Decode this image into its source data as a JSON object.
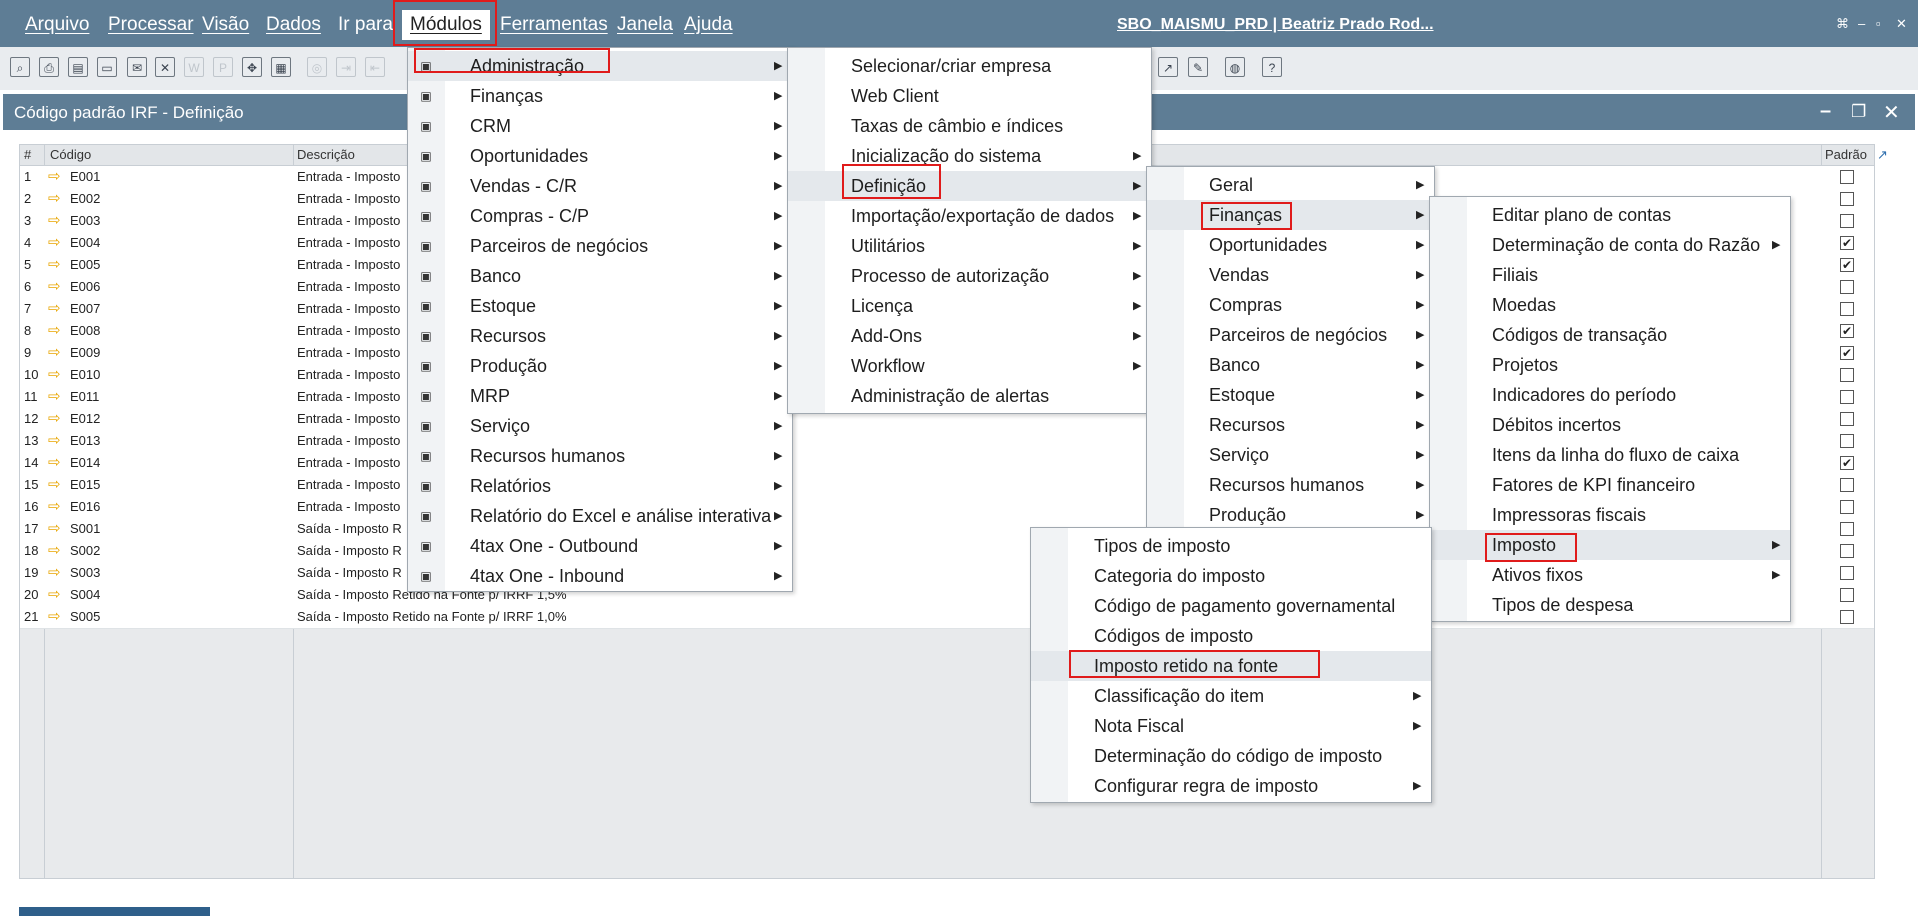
{
  "menubar": {
    "items": [
      "Arquivo",
      "Processar",
      "Visão",
      "Dados",
      "Ir para",
      "Módulos",
      "Ferramentas",
      "Janela",
      "Ajuda"
    ],
    "user_title": "SBO_MAISMU_PRD | Beatriz Prado Rod..."
  },
  "document": {
    "title": "Código padrão IRF - Definição",
    "columns": {
      "num": "#",
      "code": "Código",
      "desc": "Descrição",
      "default": "Padrão"
    },
    "rows": [
      {
        "n": "1",
        "code": "E001",
        "desc": "Entrada - Imposto",
        "default": false
      },
      {
        "n": "2",
        "code": "E002",
        "desc": "Entrada - Imposto",
        "default": false
      },
      {
        "n": "3",
        "code": "E003",
        "desc": "Entrada - Imposto",
        "default": false
      },
      {
        "n": "4",
        "code": "E004",
        "desc": "Entrada - Imposto",
        "default": true
      },
      {
        "n": "5",
        "code": "E005",
        "desc": "Entrada - Imposto",
        "default": true
      },
      {
        "n": "6",
        "code": "E006",
        "desc": "Entrada - Imposto",
        "default": false
      },
      {
        "n": "7",
        "code": "E007",
        "desc": "Entrada - Imposto",
        "default": false
      },
      {
        "n": "8",
        "code": "E008",
        "desc": "Entrada - Imposto",
        "default": true
      },
      {
        "n": "9",
        "code": "E009",
        "desc": "Entrada - Imposto",
        "default": true
      },
      {
        "n": "10",
        "code": "E010",
        "desc": "Entrada - Imposto",
        "default": false
      },
      {
        "n": "11",
        "code": "E011",
        "desc": "Entrada - Imposto",
        "default": false
      },
      {
        "n": "12",
        "code": "E012",
        "desc": "Entrada - Imposto",
        "default": false
      },
      {
        "n": "13",
        "code": "E013",
        "desc": "Entrada - Imposto",
        "default": false
      },
      {
        "n": "14",
        "code": "E014",
        "desc": "Entrada - Imposto",
        "default": true
      },
      {
        "n": "15",
        "code": "E015",
        "desc": "Entrada - Imposto",
        "default": false
      },
      {
        "n": "16",
        "code": "E016",
        "desc": "Entrada - Imposto",
        "default": false
      },
      {
        "n": "17",
        "code": "S001",
        "desc": "Saída - Imposto R",
        "default": false
      },
      {
        "n": "18",
        "code": "S002",
        "desc": "Saída - Imposto R",
        "default": false
      },
      {
        "n": "19",
        "code": "S003",
        "desc": "Saída - Imposto R",
        "default": false
      },
      {
        "n": "20",
        "code": "S004",
        "desc": "Saída - Imposto Retido na Fonte p/ IRRF 1,5%",
        "default": false
      },
      {
        "n": "21",
        "code": "S005",
        "desc": "Saída - Imposto Retido na Fonte p/ IRRF 1,0%",
        "default": false
      }
    ]
  },
  "menus": {
    "modulos": [
      "Administração",
      "Finanças",
      "CRM",
      "Oportunidades",
      "Vendas - C/R",
      "Compras - C/P",
      "Parceiros de negócios",
      "Banco",
      "Estoque",
      "Recursos",
      "Produção",
      "MRP",
      "Serviço",
      "Recursos humanos",
      "Relatórios",
      "Relatório do Excel e análise interativa",
      "4tax One - Outbound",
      "4tax One - Inbound"
    ],
    "administracao": [
      "Selecionar/criar empresa",
      "Web Client",
      "Taxas de câmbio e índices",
      "Inicialização do sistema",
      "Definição",
      "Importação/exportação de dados",
      "Utilitários",
      "Processo de autorização",
      "Licença",
      "Add-Ons",
      "Workflow",
      "Administração de alertas"
    ],
    "definicao": [
      "Geral",
      "Finanças",
      "Oportunidades",
      "Vendas",
      "Compras",
      "Parceiros de negócios",
      "Banco",
      "Estoque",
      "Recursos",
      "Serviço",
      "Recursos humanos",
      "Produção"
    ],
    "financas": [
      "Editar plano de contas",
      "Determinação de conta do Razão",
      "Filiais",
      "Moedas",
      "Códigos de transação",
      "Projetos",
      "Indicadores do período",
      "Débitos incertos",
      "Itens da linha do fluxo de caixa",
      "Fatores de KPI financeiro",
      "Impressoras fiscais",
      "Imposto",
      "Ativos fixos",
      "Tipos de despesa"
    ],
    "imposto": [
      "Tipos de imposto",
      "Categoria do imposto",
      "Código de pagamento governamental",
      "Códigos de imposto",
      "Imposto retido na fonte",
      "Classificação do item",
      "Nota Fiscal",
      "Determinação do código de imposto",
      "Configurar regra de imposto"
    ]
  }
}
